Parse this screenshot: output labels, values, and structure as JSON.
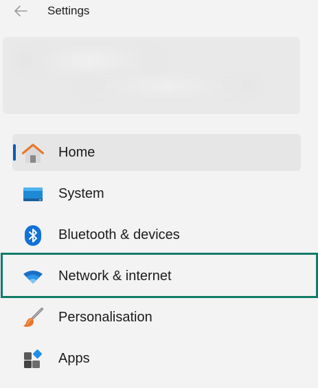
{
  "header": {
    "title": "Settings",
    "back_icon": "arrow-left-icon"
  },
  "nav": {
    "items": [
      {
        "label": "Home",
        "icon": "home-icon",
        "selected": true
      },
      {
        "label": "System",
        "icon": "monitor-icon",
        "selected": false
      },
      {
        "label": "Bluetooth & devices",
        "icon": "bluetooth-icon",
        "selected": false
      },
      {
        "label": "Network & internet",
        "icon": "wifi-icon",
        "selected": false,
        "highlighted": true
      },
      {
        "label": "Personalisation",
        "icon": "paintbrush-icon",
        "selected": false
      },
      {
        "label": "Apps",
        "icon": "apps-icon",
        "selected": false
      }
    ]
  },
  "colors": {
    "accent": "#005fb8",
    "highlight_border": "#0f7b67",
    "background": "#f3f3f3"
  }
}
